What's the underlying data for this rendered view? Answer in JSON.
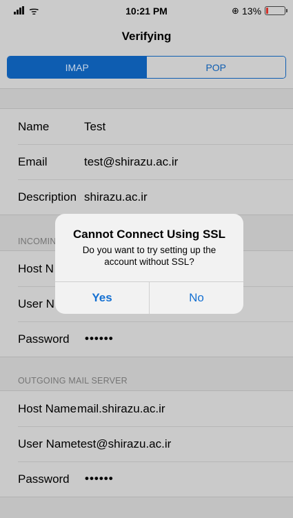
{
  "status_bar": {
    "time": "10:21 PM",
    "battery_percent": "13%",
    "battery_level": 0.13,
    "wifi_icon": "wifi-icon",
    "signal_icon": "cellular-signal-icon",
    "lock_icon": "rotation-lock-icon"
  },
  "nav": {
    "title": "Verifying"
  },
  "segmented": {
    "options": [
      "IMAP",
      "POP"
    ],
    "selected": "IMAP"
  },
  "account": {
    "name": {
      "label": "Name",
      "value": "Test"
    },
    "email": {
      "label": "Email",
      "value": "test@shirazu.ac.ir"
    },
    "description": {
      "label": "Description",
      "value": "shirazu.ac.ir"
    }
  },
  "incoming": {
    "header": "INCOMING MAIL SERVER",
    "header_visible": "INCOMIN",
    "host": {
      "label": "Host Name",
      "label_visible": "Host N"
    },
    "user": {
      "label": "User Name",
      "label_visible": "User N"
    },
    "password": {
      "label": "Password",
      "value": "••••••"
    }
  },
  "outgoing": {
    "header": "OUTGOING MAIL SERVER",
    "host": {
      "label": "Host Name",
      "value": "mail.shirazu.ac.ir"
    },
    "user": {
      "label": "User Name",
      "value": "test@shirazu.ac.ir"
    },
    "password": {
      "label": "Password",
      "value": "••••••"
    }
  },
  "alert": {
    "title": "Cannot Connect Using SSL",
    "message": "Do you want to try setting up the account without SSL?",
    "yes": "Yes",
    "no": "No"
  },
  "colors": {
    "accent": "#0f63bd",
    "alert_button": "#1470d2",
    "battery_low": "#e0342c"
  }
}
